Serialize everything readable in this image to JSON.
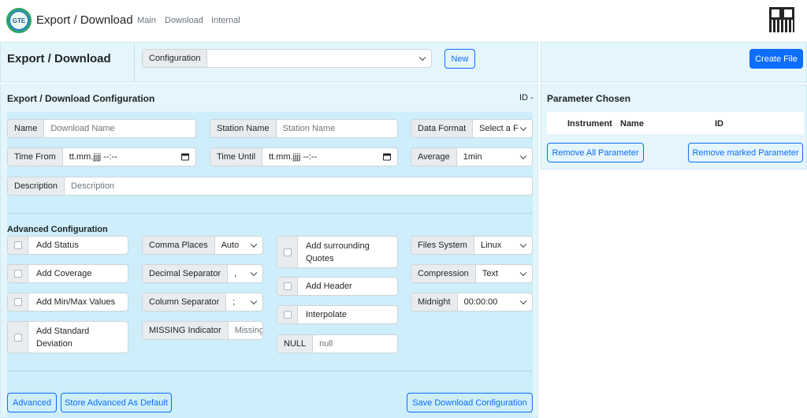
{
  "nav": {
    "brand": "Export / Download",
    "logo_text": "GTE",
    "links": [
      "Main",
      "Download",
      "Internal"
    ]
  },
  "header": {
    "title": "Export / Download",
    "configuration_label": "Configuration",
    "configuration_value": "",
    "new_label": "New",
    "create_file_label": "Create File"
  },
  "config": {
    "title": "Export / Download Configuration",
    "id_label": "ID -",
    "name": {
      "label": "Name",
      "placeholder": "Download Name"
    },
    "station_name": {
      "label": "Station Name",
      "placeholder": "Station Name"
    },
    "data_format": {
      "label": "Data Format",
      "value": "Select a F"
    },
    "time_from": {
      "label": "Time From",
      "value": "tt.mm.jjjj --:--"
    },
    "time_until": {
      "label": "Time Until",
      "value": "tt.mm.jjjj --:--"
    },
    "average": {
      "label": "Average",
      "value": "1min"
    },
    "description": {
      "label": "Description",
      "placeholder": "Description"
    }
  },
  "advanced": {
    "title": "Advanced Configuration",
    "add_status": "Add Status",
    "add_coverage": "Add Coverage",
    "add_minmax": "Add Min/Max Values",
    "add_std_line1": "Add Standard",
    "add_std_line2": "Deviation",
    "comma_places": {
      "label": "Comma Places",
      "value": "Auto"
    },
    "decimal_separator": {
      "label": "Decimal Separator",
      "value": ","
    },
    "column_separator": {
      "label": "Column Separator",
      "value": ";"
    },
    "missing_indicator": {
      "label": "MISSING Indicator",
      "placeholder": "Missing"
    },
    "add_quotes_line1": "Add surrounding",
    "add_quotes_line2": "Quotes",
    "add_header": "Add Header",
    "interpolate": "Interpolate",
    "null_field": {
      "label": "NULL",
      "placeholder": "null"
    },
    "files_system": {
      "label": "Files System",
      "value": "Linux"
    },
    "compression": {
      "label": "Compression",
      "value": "Text"
    },
    "midnight": {
      "label": "Midnight",
      "value": "00:00:00"
    }
  },
  "footer": {
    "advanced_label": "Advanced",
    "store_default_label": "Store Advanced As Default",
    "save_config_label": "Save Download Configuration"
  },
  "parameters": {
    "title": "Parameter Chosen",
    "columns": [
      "Instrument",
      "Name",
      "ID"
    ],
    "remove_all_label": "Remove All Parameter",
    "remove_marked_label": "Remove marked Parameter"
  },
  "colors": {
    "accent": "#0d6efd",
    "panel_bg": "#e4f5fb",
    "form_bg": "#cdeefa"
  }
}
